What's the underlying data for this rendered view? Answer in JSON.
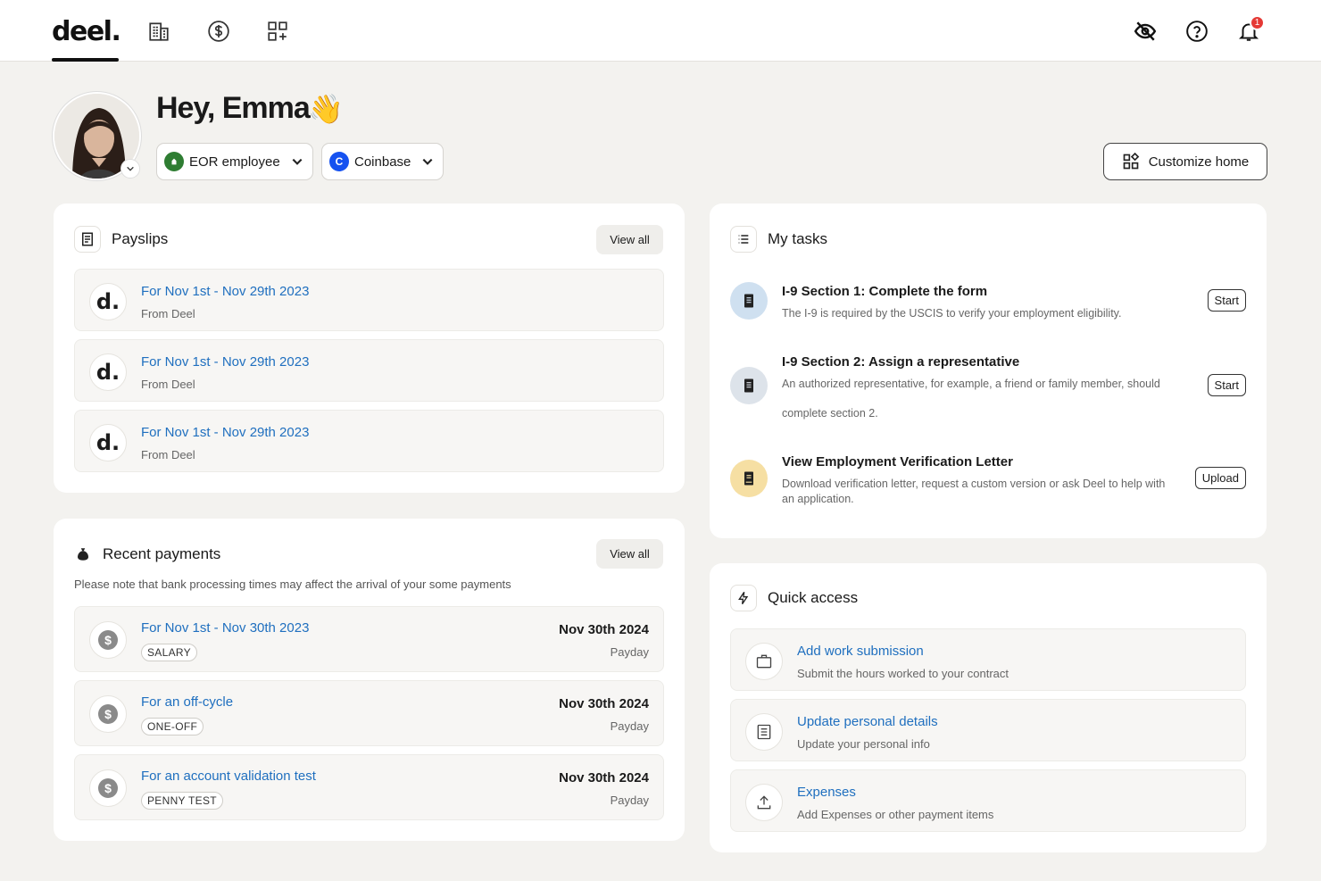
{
  "nav": {
    "logo": "deel.",
    "notification_count": "1"
  },
  "header": {
    "greeting": "Hey, Emma",
    "wave": "👋",
    "role_chip": {
      "icon_letter": "▲",
      "label": "EOR employee"
    },
    "company_chip": {
      "icon_letter": "C",
      "label": "Coinbase"
    },
    "customize_label": "Customize home"
  },
  "payslips": {
    "title": "Payslips",
    "view_all": "View all",
    "items": [
      {
        "logo": "d.",
        "title": "For Nov 1st - Nov 29th 2023",
        "from": "From Deel"
      },
      {
        "logo": "d.",
        "title": "For Nov 1st - Nov 29th 2023",
        "from": "From Deel"
      },
      {
        "logo": "d.",
        "title": "For Nov 1st - Nov 29th 2023",
        "from": "From Deel"
      }
    ]
  },
  "payments": {
    "title": "Recent payments",
    "view_all": "View all",
    "note": "Please note that bank processing times may affect the arrival of your some payments",
    "items": [
      {
        "title": "For Nov 1st - Nov 30th 2023",
        "tag": "SALARY",
        "date": "Nov 30th 2024",
        "label": "Payday"
      },
      {
        "title": "For an off-cycle",
        "tag": "ONE-OFF",
        "date": "Nov 30th 2024",
        "label": "Payday"
      },
      {
        "title": "For an account validation test",
        "tag": "PENNY TEST",
        "date": "Nov 30th 2024",
        "label": "Payday"
      }
    ]
  },
  "tasks": {
    "title": "My tasks",
    "items": [
      {
        "title": "I-9 Section 1: Complete the form",
        "desc": "The I-9 is required by the USCIS to verify your employment eligibility.",
        "button": "Start",
        "icon_bg": "#cfe0f0"
      },
      {
        "title": "I-9 Section 2: Assign a representative",
        "desc": "An authorized representative, for example, a friend or family member, should",
        "desc2": "complete section 2.",
        "button": "Start",
        "icon_bg": "#dde3ea"
      },
      {
        "title": "View Employment Verification Letter",
        "desc": "Download verification letter, request a custom version or ask Deel to help with an application.",
        "button": "Upload",
        "icon_bg": "#f6dfa3"
      }
    ]
  },
  "quick": {
    "title": "Quick access",
    "items": [
      {
        "icon": "briefcase-icon",
        "title": "Add work submission",
        "desc": "Submit the hours worked to your contract"
      },
      {
        "icon": "document-icon",
        "title": "Update personal details",
        "desc": "Update your personal info"
      },
      {
        "icon": "upload-icon",
        "title": "Expenses",
        "desc": "Add Expenses or other payment items"
      }
    ]
  },
  "colors": {
    "link": "#1f6fbf",
    "badge": "#e53935",
    "eor_green": "#2e7d32",
    "coinbase_blue": "#1652f0"
  }
}
